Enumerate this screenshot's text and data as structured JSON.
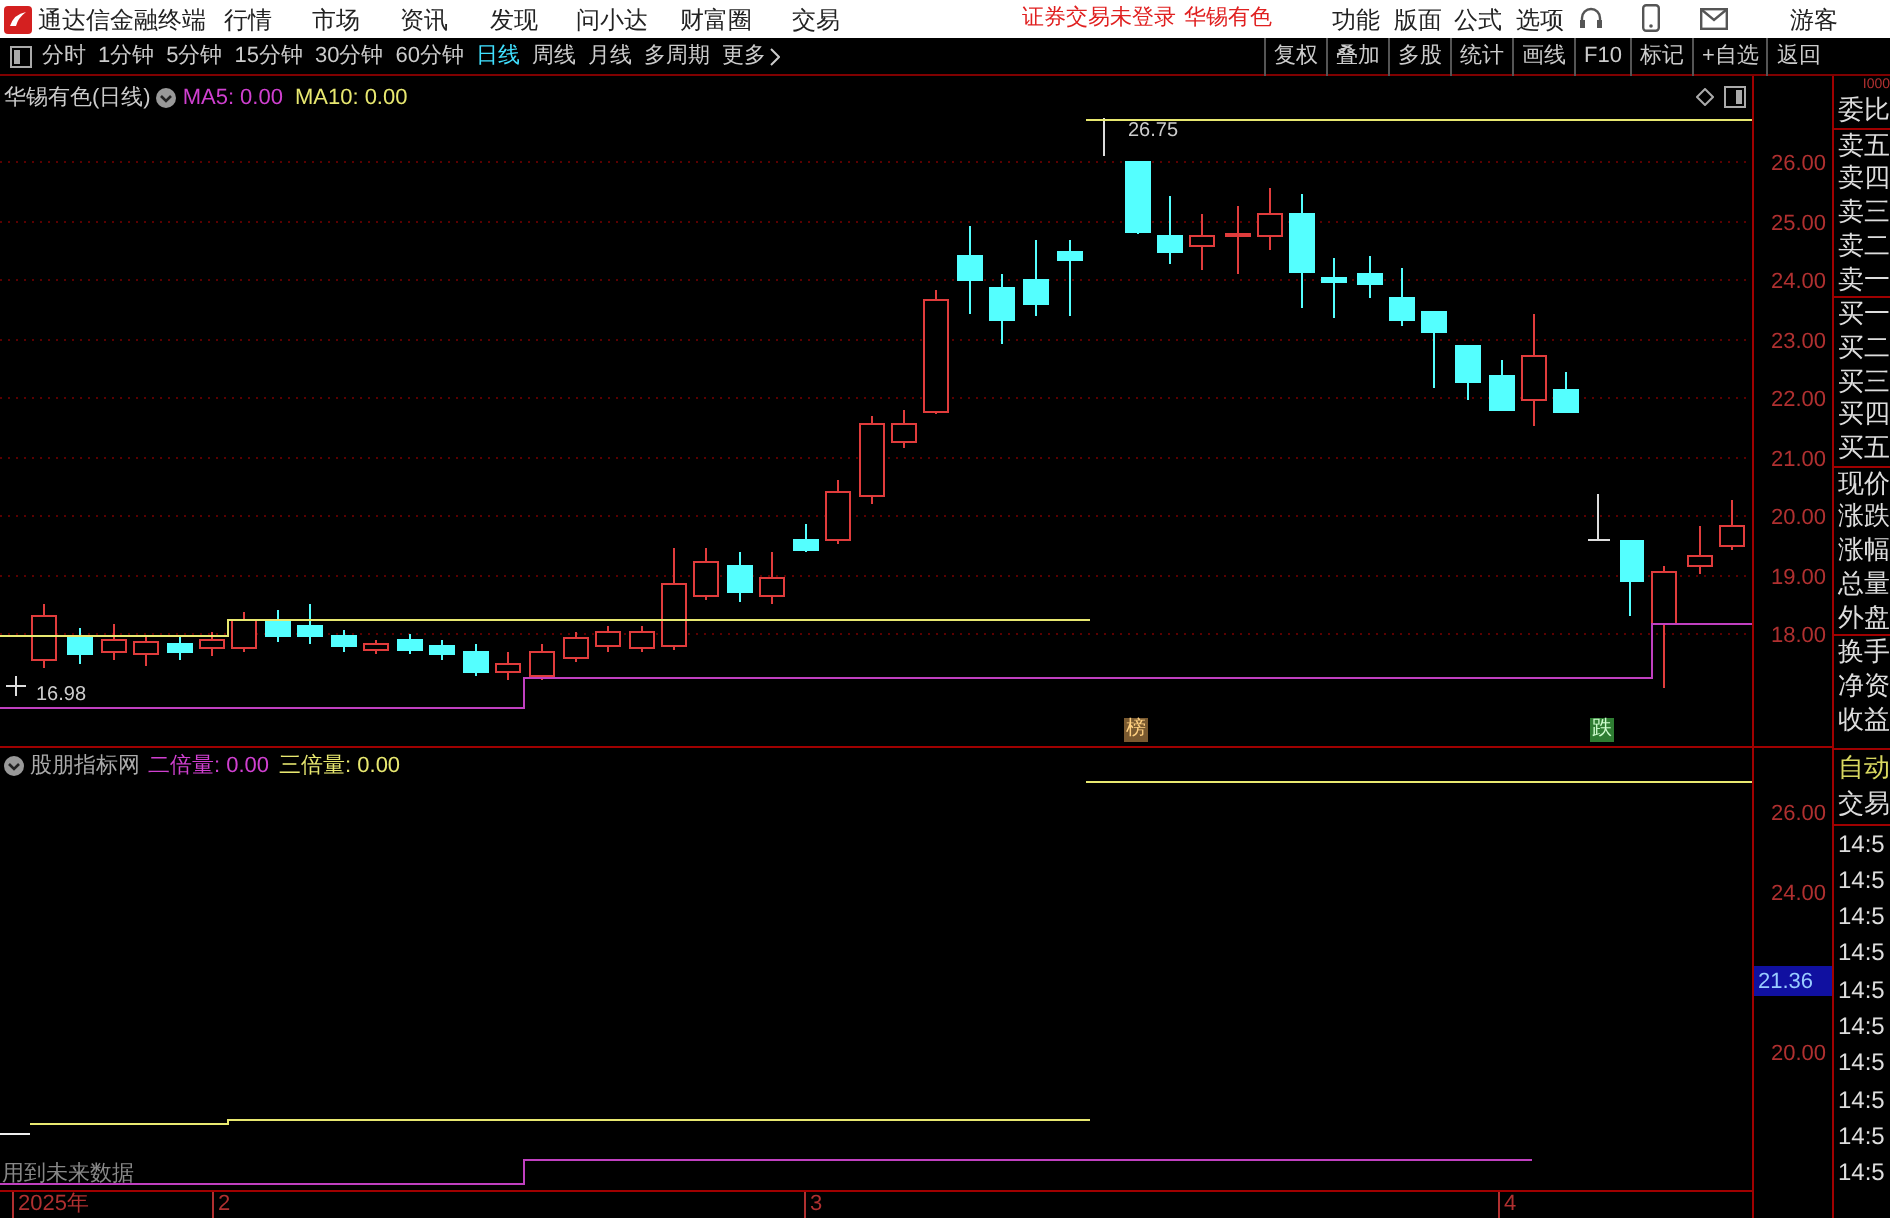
{
  "app": {
    "title": "通达信金融终端",
    "menu": [
      "行情",
      "市场",
      "资讯",
      "发现",
      "问小达",
      "财富圈",
      "交易"
    ],
    "login_status": "证券交易未登录",
    "stock_name": "华锡有色",
    "right_menu": [
      "功能",
      "版面",
      "公式",
      "选项"
    ],
    "user": "游客"
  },
  "toolbar": {
    "periods": [
      {
        "label": "分时",
        "selected": false
      },
      {
        "label": "1分钟",
        "selected": false
      },
      {
        "label": "5分钟",
        "selected": false
      },
      {
        "label": "15分钟",
        "selected": false
      },
      {
        "label": "30分钟",
        "selected": false
      },
      {
        "label": "60分钟",
        "selected": false
      },
      {
        "label": "日线",
        "selected": true
      },
      {
        "label": "周线",
        "selected": false
      },
      {
        "label": "月线",
        "selected": false
      },
      {
        "label": "多周期",
        "selected": false
      },
      {
        "label": "更多",
        "selected": false
      }
    ],
    "buttons": [
      "复权",
      "叠加",
      "多股",
      "统计",
      "画线",
      "F10",
      "标记",
      "+自选",
      "返回"
    ]
  },
  "main_chart": {
    "title": "华锡有色(日线)",
    "ma5": "MA5: 0.00",
    "ma10": "MA10: 0.00",
    "yticks": [
      "26.00",
      "25.00",
      "24.00",
      "23.00",
      "22.00",
      "21.00",
      "20.00",
      "19.00",
      "18.00"
    ],
    "high_label": "26.75",
    "low_label": "16.98",
    "signals": [
      {
        "text": "榜",
        "kind": "rise"
      },
      {
        "text": "跌",
        "kind": "fall"
      }
    ]
  },
  "indicator": {
    "name": "股朋指标网",
    "series": [
      {
        "label": "二倍量: 0.00",
        "color": "#d040d0"
      },
      {
        "label": "三倍量: 0.00",
        "color": "#e8e870"
      }
    ],
    "yticks": [
      "26.00",
      "24.00",
      "20.00"
    ],
    "current": "21.36",
    "note": "用到未来数据"
  },
  "x_axis": [
    "2025年",
    "2",
    "3",
    "4"
  ],
  "quote_panel": {
    "header": "I000",
    "labels": [
      "委比",
      "卖五",
      "卖四",
      "卖三",
      "卖二",
      "卖一",
      "买一",
      "买二",
      "买三",
      "买四",
      "买五",
      "现价",
      "涨跌",
      "涨幅",
      "总量",
      "外盘",
      "换手",
      "净资",
      "收益"
    ]
  },
  "trade_panel": {
    "labels": [
      "自动",
      "交易"
    ],
    "times": [
      "14:5",
      "14:5",
      "14:5",
      "14:5",
      "14:5",
      "14:5",
      "14:5",
      "14:5",
      "14:5",
      "14:5"
    ]
  }
}
